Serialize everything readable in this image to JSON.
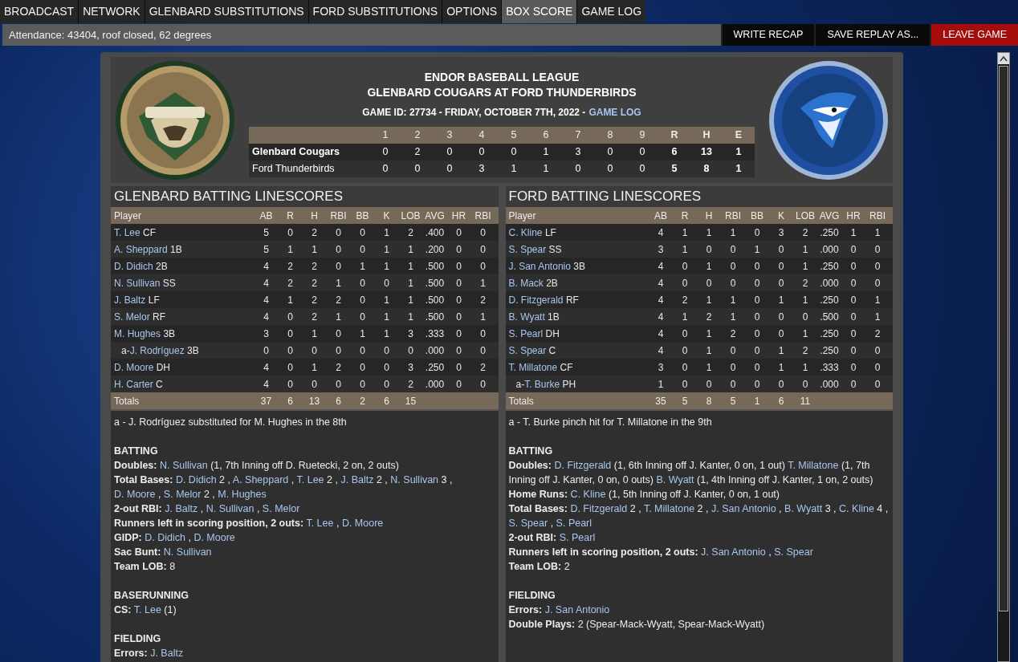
{
  "tabs": [
    {
      "label": "BROADCAST",
      "selected": false
    },
    {
      "label": "NETWORK",
      "selected": false
    },
    {
      "label": "GLENBARD SUBSTITUTIONS",
      "selected": false
    },
    {
      "label": "FORD SUBSTITUTIONS",
      "selected": false
    },
    {
      "label": "OPTIONS",
      "selected": false
    },
    {
      "label": "BOX SCORE",
      "selected": true
    },
    {
      "label": "GAME LOG",
      "selected": false
    }
  ],
  "status": "Attendance: 43404, roof closed, 62 degrees",
  "actions": [
    {
      "label": "WRITE RECAP",
      "kind": "normal"
    },
    {
      "label": "SAVE REPLAY AS...",
      "kind": "normal"
    },
    {
      "label": "LEAVE GAME",
      "kind": "danger"
    }
  ],
  "header": {
    "league": "ENDOR BASEBALL LEAGUE",
    "matchup": "GLENBARD COUGARS AT FORD THUNDERBIRDS",
    "game_info": "GAME ID: 27734 - FRIDAY, OCTOBER 7TH, 2022 -",
    "game_log_link": "GAME LOG"
  },
  "linescore": {
    "columns": [
      "1",
      "2",
      "3",
      "4",
      "5",
      "6",
      "7",
      "8",
      "9",
      "R",
      "H",
      "E"
    ],
    "rows": [
      {
        "team": "Glenbard Cougars",
        "winner": true,
        "values": [
          "0",
          "2",
          "0",
          "0",
          "0",
          "1",
          "3",
          "0",
          "0",
          "6",
          "13",
          "1"
        ]
      },
      {
        "team": "Ford Thunderbirds",
        "winner": false,
        "values": [
          "0",
          "0",
          "0",
          "3",
          "1",
          "1",
          "0",
          "0",
          "0",
          "5",
          "8",
          "1"
        ]
      }
    ]
  },
  "teams": [
    {
      "title": "GLENBARD BATTING LINESCORES",
      "columns": [
        "Player",
        "AB",
        "R",
        "H",
        "RBI",
        "BB",
        "K",
        "LOB",
        "AVG",
        "HR",
        "RBI"
      ],
      "rows": [
        {
          "name": "T. Lee",
          "pos": "CF",
          "sub": false,
          "stats": [
            "5",
            "0",
            "2",
            "0",
            "0",
            "1",
            "2",
            ".400",
            "0",
            "0"
          ]
        },
        {
          "name": "A. Sheppard",
          "pos": "1B",
          "sub": false,
          "stats": [
            "5",
            "1",
            "1",
            "0",
            "0",
            "1",
            "1",
            ".200",
            "0",
            "0"
          ]
        },
        {
          "name": "D. Didich",
          "pos": "2B",
          "sub": false,
          "stats": [
            "4",
            "2",
            "2",
            "0",
            "1",
            "1",
            "1",
            ".500",
            "0",
            "0"
          ]
        },
        {
          "name": "N. Sullivan",
          "pos": "SS",
          "sub": false,
          "stats": [
            "4",
            "2",
            "2",
            "1",
            "0",
            "0",
            "1",
            ".500",
            "0",
            "1"
          ]
        },
        {
          "name": "J. Baltz",
          "pos": "LF",
          "sub": false,
          "stats": [
            "4",
            "1",
            "2",
            "2",
            "0",
            "1",
            "1",
            ".500",
            "0",
            "2"
          ]
        },
        {
          "name": "S. Melor",
          "pos": "RF",
          "sub": false,
          "stats": [
            "4",
            "0",
            "2",
            "1",
            "0",
            "1",
            "1",
            ".500",
            "0",
            "1"
          ]
        },
        {
          "name": "M. Hughes",
          "pos": "3B",
          "sub": false,
          "stats": [
            "3",
            "0",
            "1",
            "0",
            "1",
            "1",
            "3",
            ".333",
            "0",
            "0"
          ]
        },
        {
          "prefix": "a-",
          "name": "J. Rodríguez",
          "pos": "3B",
          "sub": true,
          "stats": [
            "0",
            "0",
            "0",
            "0",
            "0",
            "0",
            "0",
            ".000",
            "0",
            "0"
          ]
        },
        {
          "name": "D. Moore",
          "pos": "DH",
          "sub": false,
          "stats": [
            "4",
            "0",
            "1",
            "2",
            "0",
            "0",
            "3",
            ".250",
            "0",
            "2"
          ]
        },
        {
          "name": "H. Carter",
          "pos": "C",
          "sub": false,
          "stats": [
            "4",
            "0",
            "0",
            "0",
            "0",
            "0",
            "2",
            ".000",
            "0",
            "0"
          ]
        }
      ],
      "totals": {
        "label": "Totals",
        "stats": [
          "37",
          "6",
          "13",
          "6",
          "2",
          "6",
          "15"
        ]
      },
      "notes": [
        {
          "kind": "footnote",
          "text": "a - J. Rodríguez substituted for M. Hughes in the 8th"
        },
        {
          "kind": "heading",
          "text": "BATTING"
        },
        {
          "kind": "stat",
          "label": "Doubles:",
          "items": [
            {
              "name": "N. Sullivan",
              "rest": "(1, 7th Inning off D. Ruetecki, 2 on, 2 outs)"
            }
          ]
        },
        {
          "kind": "stat",
          "label": "Total Bases:",
          "items": [
            {
              "name": "D. Didich",
              "rest": "2 ,"
            },
            {
              "name": "A. Sheppard",
              "rest": ","
            },
            {
              "name": "T. Lee",
              "rest": "2 ,"
            },
            {
              "name": "J. Baltz",
              "rest": "2 ,"
            },
            {
              "name": "N. Sullivan",
              "rest": "3 ,"
            },
            {
              "name": "D. Moore",
              "rest": ", "
            },
            {
              "name": "S. Melor",
              "rest": "2 ,"
            },
            {
              "name": "M. Hughes"
            }
          ]
        },
        {
          "kind": "stat",
          "label": "2-out RBI:",
          "items": [
            {
              "name": "J. Baltz",
              "rest": ","
            },
            {
              "name": "N. Sullivan",
              "rest": ","
            },
            {
              "name": "S. Melor"
            }
          ]
        },
        {
          "kind": "stat",
          "label": "Runners left in scoring position, 2 outs:",
          "items": [
            {
              "name": "T. Lee",
              "rest": ","
            },
            {
              "name": "D. Moore"
            }
          ]
        },
        {
          "kind": "stat",
          "label": "GIDP:",
          "items": [
            {
              "name": "D. Didich",
              "rest": ","
            },
            {
              "name": "D. Moore"
            }
          ]
        },
        {
          "kind": "stat",
          "label": "Sac Bunt:",
          "items": [
            {
              "name": "N. Sullivan"
            }
          ]
        },
        {
          "kind": "stat",
          "label": "Team LOB:",
          "items": [
            {
              "rest": "8"
            }
          ]
        },
        {
          "kind": "heading",
          "text": "BASERUNNING"
        },
        {
          "kind": "stat",
          "label": "CS:",
          "items": [
            {
              "name": "T. Lee",
              "rest": "(1)"
            }
          ]
        },
        {
          "kind": "heading",
          "text": "FIELDING"
        },
        {
          "kind": "stat",
          "label": "Errors:",
          "items": [
            {
              "name": "J. Baltz"
            }
          ]
        }
      ]
    },
    {
      "title": "FORD BATTING LINESCORES",
      "columns": [
        "Player",
        "AB",
        "R",
        "H",
        "RBI",
        "BB",
        "K",
        "LOB",
        "AVG",
        "HR",
        "RBI"
      ],
      "rows": [
        {
          "name": "C. Kline",
          "pos": "LF",
          "sub": false,
          "stats": [
            "4",
            "1",
            "1",
            "1",
            "0",
            "3",
            "2",
            ".250",
            "1",
            "1"
          ]
        },
        {
          "name": "S. Spear",
          "pos": "SS",
          "sub": false,
          "stats": [
            "3",
            "1",
            "0",
            "0",
            "1",
            "0",
            "1",
            ".000",
            "0",
            "0"
          ]
        },
        {
          "name": "J. San Antonio",
          "pos": "3B",
          "sub": false,
          "stats": [
            "4",
            "0",
            "1",
            "0",
            "0",
            "0",
            "1",
            ".250",
            "0",
            "0"
          ]
        },
        {
          "name": "B. Mack",
          "pos": "2B",
          "sub": false,
          "stats": [
            "4",
            "0",
            "0",
            "0",
            "0",
            "0",
            "2",
            ".000",
            "0",
            "0"
          ]
        },
        {
          "name": "D. Fitzgerald",
          "pos": "RF",
          "sub": false,
          "stats": [
            "4",
            "2",
            "1",
            "1",
            "0",
            "1",
            "1",
            ".250",
            "0",
            "1"
          ]
        },
        {
          "name": "B. Wyatt",
          "pos": "1B",
          "sub": false,
          "stats": [
            "4",
            "1",
            "2",
            "1",
            "0",
            "0",
            "0",
            ".500",
            "0",
            "1"
          ]
        },
        {
          "name": "S. Pearl",
          "pos": "DH",
          "sub": false,
          "stats": [
            "4",
            "0",
            "1",
            "2",
            "0",
            "0",
            "1",
            ".250",
            "0",
            "2"
          ]
        },
        {
          "name": "S. Spear",
          "pos": "C",
          "sub": false,
          "stats": [
            "4",
            "0",
            "1",
            "0",
            "0",
            "1",
            "2",
            ".250",
            "0",
            "0"
          ]
        },
        {
          "name": "T. Millatone",
          "pos": "CF",
          "sub": false,
          "stats": [
            "3",
            "0",
            "1",
            "0",
            "0",
            "1",
            "1",
            ".333",
            "0",
            "0"
          ]
        },
        {
          "prefix": "a-",
          "name": "T. Burke",
          "pos": "PH",
          "sub": true,
          "stats": [
            "1",
            "0",
            "0",
            "0",
            "0",
            "0",
            "0",
            ".000",
            "0",
            "0"
          ]
        }
      ],
      "totals": {
        "label": "Totals",
        "stats": [
          "35",
          "5",
          "8",
          "5",
          "1",
          "6",
          "11"
        ]
      },
      "notes": [
        {
          "kind": "footnote",
          "text": "a - T. Burke pinch hit for T. Millatone in the 9th"
        },
        {
          "kind": "heading",
          "text": "BATTING"
        },
        {
          "kind": "stat",
          "label": "Doubles:",
          "items": [
            {
              "name": "D. Fitzgerald",
              "rest": "(1, 6th Inning off J. Kanter, 0 on, 1 out)"
            },
            {
              "name": "T. Millatone",
              "rest": "(1, 7th Inning off J. Kanter, 0 on, 0 outs)"
            },
            {
              "name": "B. Wyatt",
              "rest": "(1, 4th Inning off J. Kanter, 1 on, 2 outs)"
            }
          ]
        },
        {
          "kind": "stat",
          "label": "Home Runs:",
          "items": [
            {
              "name": "C. Kline",
              "rest": "(1, 5th Inning off J. Kanter, 0 on, 1 out)"
            }
          ]
        },
        {
          "kind": "stat",
          "label": "Total Bases:",
          "items": [
            {
              "name": "D. Fitzgerald",
              "rest": "2 ,"
            },
            {
              "name": "T. Millatone",
              "rest": "2 ,"
            },
            {
              "name": "J. San Antonio",
              "rest": ","
            },
            {
              "name": "B. Wyatt",
              "rest": "3 ,"
            },
            {
              "name": "C. Kline",
              "rest": "4 ,"
            },
            {
              "name": "S. Spear",
              "rest": ","
            },
            {
              "name": "S. Pearl"
            }
          ]
        },
        {
          "kind": "stat",
          "label": "2-out RBI:",
          "items": [
            {
              "name": "S. Pearl"
            }
          ]
        },
        {
          "kind": "stat",
          "label": "Runners left in scoring position, 2 outs:",
          "items": [
            {
              "name": "J. San Antonio",
              "rest": ","
            },
            {
              "name": "S. Spear"
            }
          ]
        },
        {
          "kind": "stat",
          "label": "Team LOB:",
          "items": [
            {
              "rest": "2"
            }
          ]
        },
        {
          "kind": "heading",
          "text": "FIELDING"
        },
        {
          "kind": "stat",
          "label": "Errors:",
          "items": [
            {
              "name": "J. San Antonio"
            }
          ]
        },
        {
          "kind": "stat",
          "label": "Double Plays:",
          "items": [
            {
              "rest": "2 (Spear-Mack-Wyatt, Spear-Mack-Wyatt)"
            }
          ]
        }
      ]
    }
  ]
}
